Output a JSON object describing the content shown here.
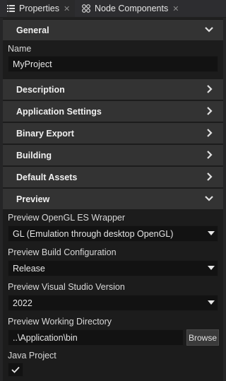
{
  "tabs": [
    {
      "label": "Properties",
      "icon": "list-icon",
      "close": "✕"
    },
    {
      "label": "Node Components",
      "icon": "components-icon",
      "close": "✕"
    }
  ],
  "sections": {
    "general": "General",
    "description": "Description",
    "application_settings": "Application Settings",
    "binary_export": "Binary Export",
    "building": "Building",
    "default_assets": "Default Assets",
    "preview": "Preview"
  },
  "general": {
    "name_label": "Name",
    "name_value": "MyProject"
  },
  "preview": {
    "wrapper_label": "Preview OpenGL ES Wrapper",
    "wrapper_value": "GL (Emulation through desktop OpenGL)",
    "build_config_label": "Preview Build Configuration",
    "build_config_value": "Release",
    "vs_version_label": "Preview Visual Studio Version",
    "vs_version_value": "2022",
    "working_dir_label": "Preview Working Directory",
    "working_dir_value": "..\\Application\\bin",
    "browse_label": "Browse",
    "java_project_label": "Java Project",
    "java_project_checked": true
  },
  "colors": {
    "background": "#252526",
    "section_header": "#333333",
    "field": "#121212"
  }
}
